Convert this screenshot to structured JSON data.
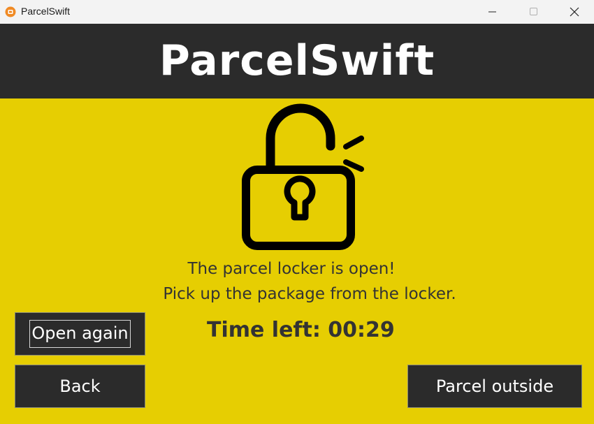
{
  "window": {
    "title": "ParcelSwift",
    "app_icon": "parcelswift-app-icon",
    "controls": [
      "minimize-icon",
      "maximize-icon",
      "close-icon"
    ]
  },
  "header": {
    "title": "ParcelSwift"
  },
  "status": {
    "icon": "open-padlock-icon",
    "line1": "The parcel locker is open!",
    "line2": "Pick up the package from the locker.",
    "timer": "Time left: 00:29"
  },
  "buttons": {
    "open_again": "Open again",
    "back": "Back",
    "parcel_outside": "Parcel outside"
  },
  "colors": {
    "background": "#e6ce02",
    "header": "#2b2b2b",
    "button": "#2b2b2b",
    "text": "#333333",
    "app_icon": "#f08a24"
  }
}
